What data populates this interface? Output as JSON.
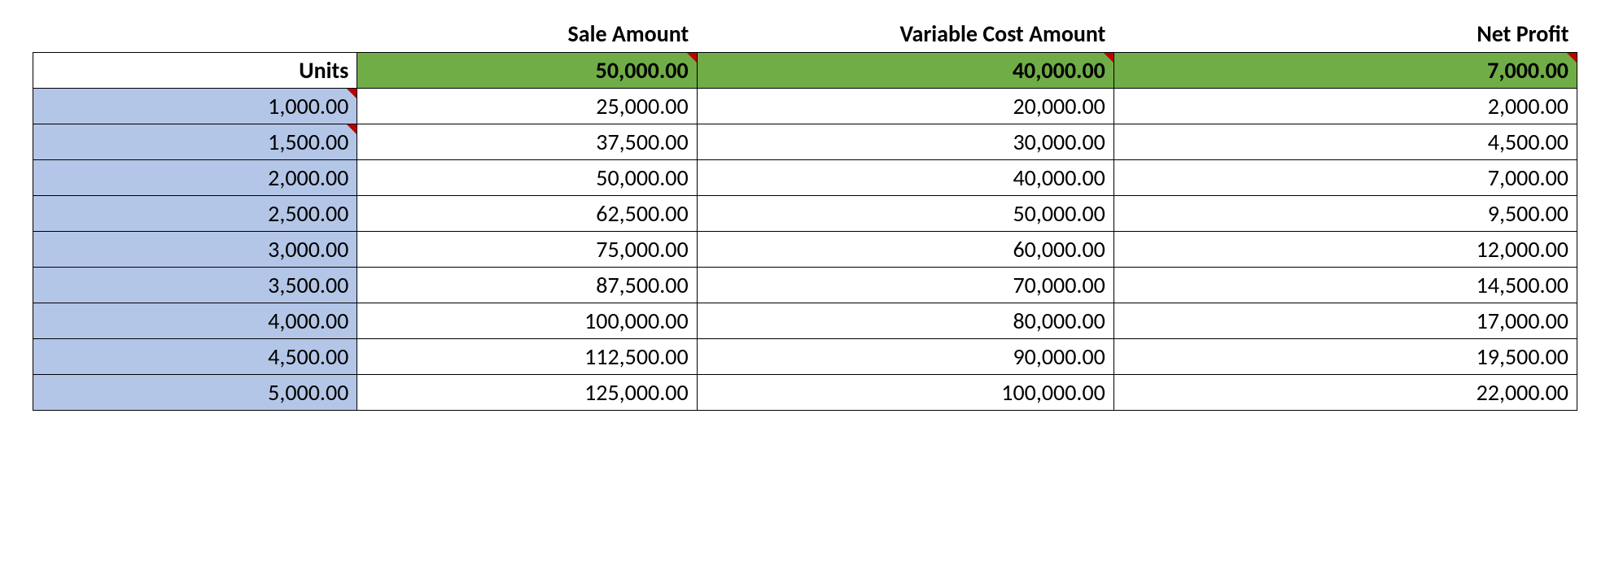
{
  "headers": {
    "units": "Units",
    "sale": "Sale Amount",
    "variable_cost": "Variable Cost Amount",
    "net_profit": "Net Profit"
  },
  "summary": {
    "sale": "50,000.00",
    "variable_cost": "40,000.00",
    "net_profit": "7,000.00"
  },
  "rows": [
    {
      "units": "1,000.00",
      "sale": "25,000.00",
      "variable_cost": "20,000.00",
      "net_profit": "2,000.00",
      "units_marker": true
    },
    {
      "units": "1,500.00",
      "sale": "37,500.00",
      "variable_cost": "30,000.00",
      "net_profit": "4,500.00",
      "units_marker": true
    },
    {
      "units": "2,000.00",
      "sale": "50,000.00",
      "variable_cost": "40,000.00",
      "net_profit": "7,000.00",
      "units_marker": false
    },
    {
      "units": "2,500.00",
      "sale": "62,500.00",
      "variable_cost": "50,000.00",
      "net_profit": "9,500.00",
      "units_marker": false
    },
    {
      "units": "3,000.00",
      "sale": "75,000.00",
      "variable_cost": "60,000.00",
      "net_profit": "12,000.00",
      "units_marker": false
    },
    {
      "units": "3,500.00",
      "sale": "87,500.00",
      "variable_cost": "70,000.00",
      "net_profit": "14,500.00",
      "units_marker": false
    },
    {
      "units": "4,000.00",
      "sale": "100,000.00",
      "variable_cost": "80,000.00",
      "net_profit": "17,000.00",
      "units_marker": false
    },
    {
      "units": "4,500.00",
      "sale": "112,500.00",
      "variable_cost": "90,000.00",
      "net_profit": "19,500.00",
      "units_marker": false
    },
    {
      "units": "5,000.00",
      "sale": "125,000.00",
      "variable_cost": "100,000.00",
      "net_profit": "22,000.00",
      "units_marker": false
    }
  ]
}
